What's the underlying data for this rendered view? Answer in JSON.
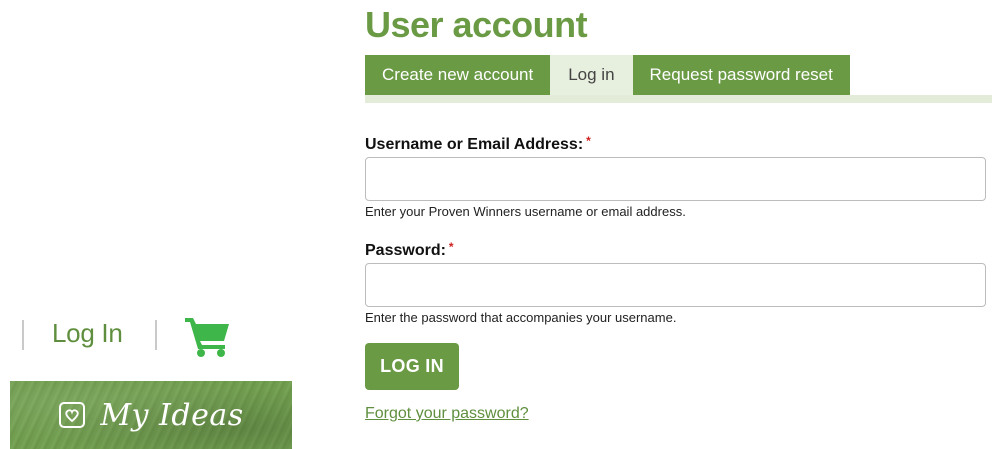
{
  "header": {
    "login_label": "Log In",
    "myideas_label": "My Ideas"
  },
  "icons": {
    "cart": "shopping-cart-icon",
    "my_ideas": "heart-box-icon"
  },
  "colors": {
    "brand_green": "#6b9a45",
    "link_green": "#5f8f3e",
    "active_tab_bg": "#e7efdf",
    "required_red": "#d02020"
  },
  "page": {
    "title": "User account"
  },
  "tabs": [
    {
      "label": "Create new account",
      "active": false
    },
    {
      "label": "Log in",
      "active": true
    },
    {
      "label": "Request password reset",
      "active": false
    }
  ],
  "form": {
    "username": {
      "label": "Username or Email Address:",
      "required_mark": "*",
      "value": "",
      "help": "Enter your Proven Winners username or email address."
    },
    "password": {
      "label": "Password:",
      "required_mark": "*",
      "value": "",
      "help": "Enter the password that accompanies your username."
    },
    "submit_label": "LOG IN",
    "forgot_label": "Forgot your password?"
  }
}
